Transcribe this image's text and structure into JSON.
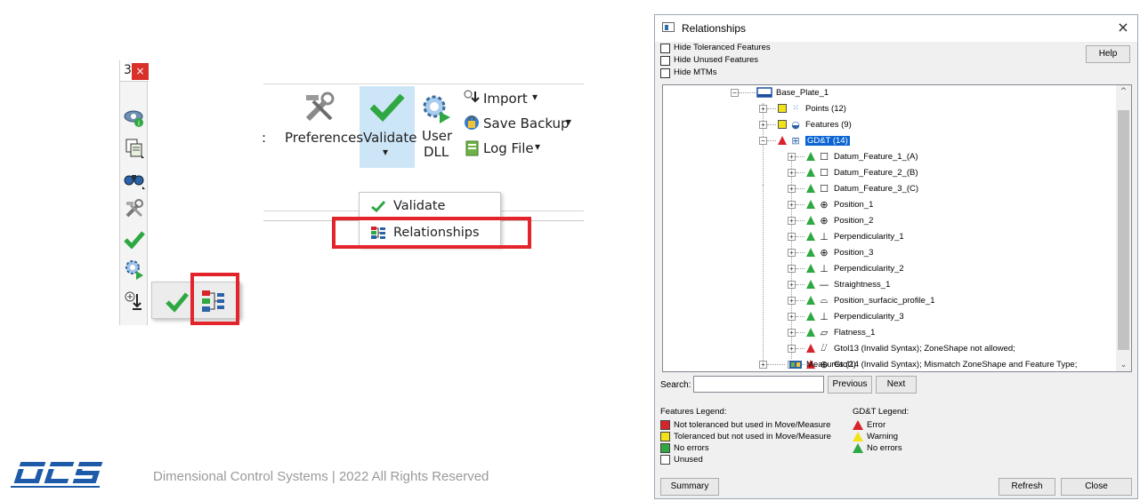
{
  "vertical_toolbar": {
    "tab_number": "3",
    "close_glyph": "×",
    "buttons": [
      "eye-info-icon",
      "copy-icon",
      "binoculars-icon",
      "tools-icon",
      "validate-check-icon",
      "gear-user-dll-icon",
      "import-icon"
    ]
  },
  "flyout": {
    "buttons": [
      "validate-check-icon",
      "relationships-icon"
    ]
  },
  "ribbon": {
    "preferences_prefix": ":",
    "preferences_label": "Preferences",
    "validate_label": "Validate",
    "validate_arrow": "▾",
    "user_dll_line1": "User",
    "user_dll_line2": "DLL",
    "import_label": "Import",
    "save_backup_label": "Save Backup",
    "log_file_label": "Log File",
    "menu_arrow": "▾"
  },
  "dropdown": {
    "items": [
      "Validate",
      "Relationships"
    ]
  },
  "footer": {
    "text": "Dimensional Control Systems | 2022 All Rights Reserved",
    "logo_text": "DCS"
  },
  "dialog": {
    "title": "Relationships",
    "close_glyph": "×",
    "checkboxes": [
      "Hide Toleranced Features",
      "Hide Unused Features",
      "Hide MTMs"
    ],
    "help_label": "Help",
    "tree": {
      "root": "Base_Plate_1",
      "points": "Points (12)",
      "features": "Features (9)",
      "gdt": "GD&T (14)",
      "gdt_children": [
        {
          "label": "Datum_Feature_1_(A)",
          "symbol": "datum",
          "status": "ok"
        },
        {
          "label": "Datum_Feature_2_(B)",
          "symbol": "datum",
          "status": "ok"
        },
        {
          "label": "Datum_Feature_3_(C)",
          "symbol": "datum",
          "status": "ok"
        },
        {
          "label": "Position_1",
          "symbol": "position",
          "status": "ok"
        },
        {
          "label": "Position_2",
          "symbol": "position",
          "status": "ok"
        },
        {
          "label": "Perpendicularity_1",
          "symbol": "perpendicularity",
          "status": "ok"
        },
        {
          "label": "Position_3",
          "symbol": "position",
          "status": "ok"
        },
        {
          "label": "Perpendicularity_2",
          "symbol": "perpendicularity",
          "status": "ok"
        },
        {
          "label": "Straightness_1",
          "symbol": "straightness",
          "status": "ok"
        },
        {
          "label": "Position_surfacic_profile_1",
          "symbol": "profile",
          "status": "ok"
        },
        {
          "label": "Perpendicularity_3",
          "symbol": "perpendicularity",
          "status": "ok"
        },
        {
          "label": "Flatness_1",
          "symbol": "flatness",
          "status": "ok"
        },
        {
          "label": "Gtol13 (Invalid Syntax); ZoneShape not allowed;",
          "symbol": "runout",
          "status": "error"
        },
        {
          "label": "Gtol14 (Invalid Syntax); Mismatch ZoneShape and Feature Type;",
          "symbol": "position",
          "status": "error"
        }
      ],
      "measures": "Measures (2)"
    },
    "search_label": "Search:",
    "search_value": "",
    "previous_label": "Previous",
    "next_label": "Next",
    "features_legend_title": "Features Legend:",
    "features_legend": [
      {
        "label": "Not toleranced but used in Move/Measure",
        "color": "#d8232a"
      },
      {
        "label": "Toleranced but not used in Move/Measure",
        "color": "#f2e21a"
      },
      {
        "label": "No errors",
        "color": "#2fa844"
      },
      {
        "label": "Unused",
        "color": "#ffffff"
      }
    ],
    "gdt_legend_title": "GD&T Legend:",
    "gdt_legend": [
      {
        "label": "Error",
        "color": "#d8232a"
      },
      {
        "label": "Warning",
        "color": "#f2e21a"
      },
      {
        "label": "No errors",
        "color": "#2fa844"
      }
    ],
    "summary_label": "Summary",
    "refresh_label": "Refresh",
    "close_label": "Close"
  },
  "colors": {
    "highlight_red": "#e3242b",
    "selection_blue": "#0a64d2",
    "ribbon_selected": "#cde6f7"
  }
}
